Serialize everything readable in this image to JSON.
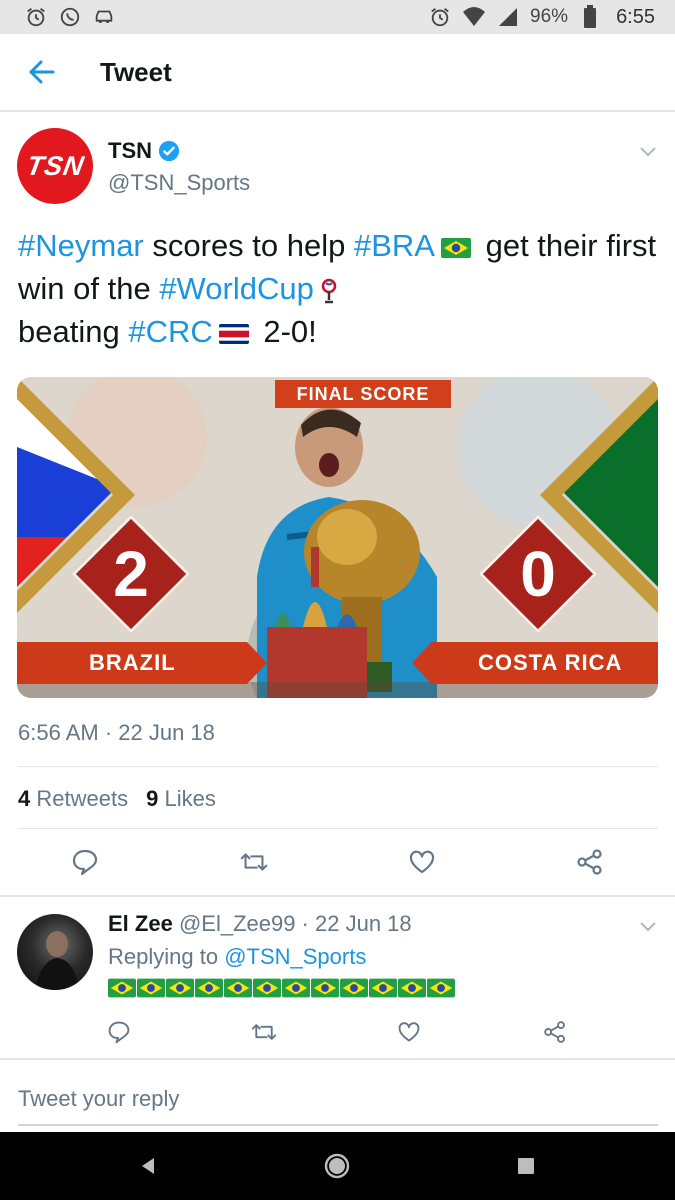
{
  "status_bar": {
    "left_icons": [
      "alarm-icon",
      "whatsapp-icon",
      "car-icon"
    ],
    "right_icons": [
      "alarm-icon",
      "wifi-icon",
      "signal-icon",
      "battery-icon"
    ],
    "battery": "96%",
    "time": "6:55"
  },
  "appbar": {
    "title": "Tweet"
  },
  "tweet": {
    "author_name": "TSN",
    "author_handle": "@TSN_Sports",
    "avatar_text": "TSN",
    "text_parts": {
      "t1": "#Neymar",
      "t2": " scores to help ",
      "t3": "#BRA",
      "t4": " get their first win of the ",
      "t5": "#WorldCup",
      "t6": " beating ",
      "t7": "#CRC",
      "t8": " 2-0!"
    },
    "media": {
      "banner": "FINAL SCORE",
      "home_score": "2",
      "away_score": "0",
      "home_team": "BRAZIL",
      "away_team": "COSTA RICA"
    },
    "timestamp": "6:56 AM · 22 Jun 18",
    "retweets_count": "4",
    "retweets_label": "Retweets",
    "likes_count": "9",
    "likes_label": "Likes"
  },
  "reply": {
    "name": "El Zee",
    "handle_date": "@El_Zee99 · 22 Jun 18",
    "replying_prefix": "Replying to ",
    "replying_handle": "@TSN_Sports",
    "flag_count": 12
  },
  "compose": {
    "placeholder": "Tweet your reply"
  },
  "colors": {
    "link": "#1b95e0",
    "secondary": "#657786",
    "tsn_red": "#e1191f"
  }
}
